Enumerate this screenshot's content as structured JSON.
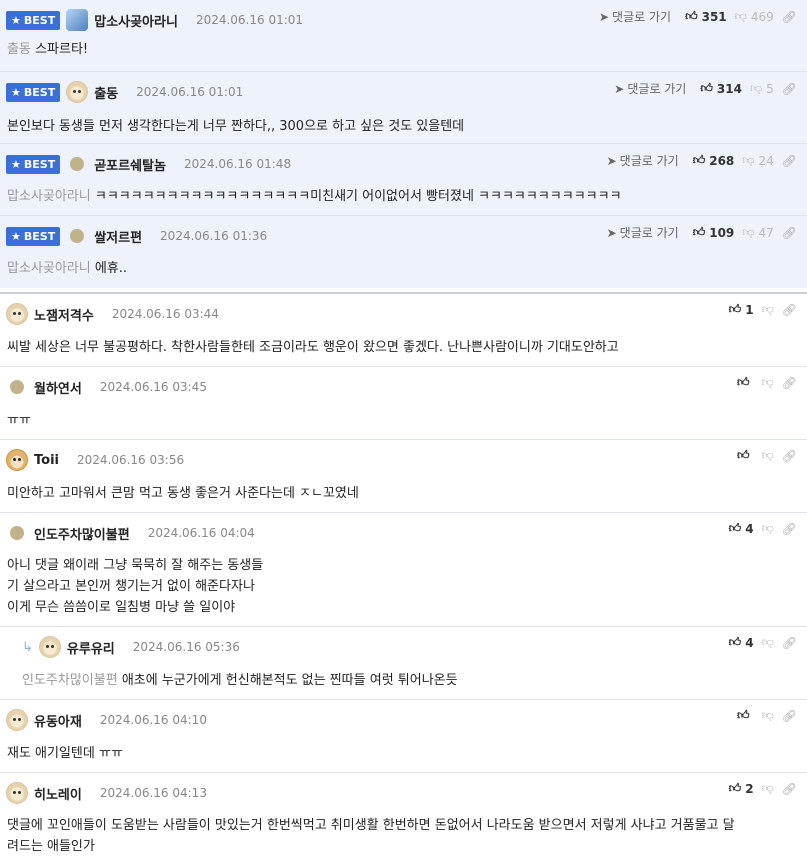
{
  "best_comments": [
    {
      "badge": "BEST",
      "avatar": "picture-avatar",
      "nick": "맙소사곶아라니",
      "date": "2024.06.16 01:01",
      "reply": "댓글로 가기",
      "up": "351",
      "down": "469",
      "mention": "",
      "text": "출동 스파르타!",
      "text_prefix": "출동"
    },
    {
      "badge": "BEST",
      "avatar": "dog-avatar",
      "nick": "출동",
      "date": "2024.06.16 01:01",
      "reply": "댓글로 가기",
      "up": "314",
      "down": "5",
      "mention": "",
      "text": "본인보다 동생들 먼저 생각한다는게 너무 짠하다,, 300으로 하고 싶은 것도 있을텐데"
    },
    {
      "badge": "BEST",
      "avatar": "dot-avatar",
      "nick": "곧포르쉐탈놈",
      "date": "2024.06.16 01:48",
      "reply": "댓글로 가기",
      "up": "268",
      "down": "24",
      "mention": "맙소사곶아라니",
      "text": "ㅋㅋㅋㅋㅋㅋㅋㅋㅋㅋㅋㅋㅋㅋㅋㅋㅋㅋ미친새기 어이없어서 빵터졌네 ㅋㅋㅋㅋㅋㅋㅋㅋㅋㅋㅋㅋ"
    },
    {
      "badge": "BEST",
      "avatar": "dot-avatar",
      "nick": "쌀저르편",
      "date": "2024.06.16 01:36",
      "reply": "댓글로 가기",
      "up": "109",
      "down": "47",
      "mention": "맙소사곶아라니",
      "text": "에휴.."
    }
  ],
  "comments": [
    {
      "avatar": "dog-avatar",
      "nick": "노잼저격수",
      "date": "2024.06.16 03:44",
      "up": "1",
      "lines": [
        "씨발 세상은 너무 불공평하다. 착한사람들한테 조금이라도 행운이 왔으면 좋겠다. 난나쁜사람이니까 기대도안하고"
      ]
    },
    {
      "avatar": "dot-avatar",
      "nick": "월하연서",
      "date": "2024.06.16 03:45",
      "up": "",
      "lines": [
        "ㅠㅠ"
      ]
    },
    {
      "avatar": "fox-avatar",
      "nick": "Toii",
      "date": "2024.06.16 03:56",
      "up": "",
      "lines": [
        "미안하고 고마워서 큰맘 먹고 동생 좋은거 사준다는데 ㅈㄴ꼬였네"
      ]
    },
    {
      "avatar": "dot-avatar",
      "nick": "인도주차많이불편",
      "date": "2024.06.16 04:04",
      "up": "4",
      "lines": [
        "아니 댓글 왜이래 그냥 묵묵히 잘 해주는 동생들",
        "기 살으라고 본인꺼 챙기는거 없이 해준다자나",
        "이게 무슨 씀씀이로 일침병 마냥 쓸 일이야"
      ]
    },
    {
      "avatar": "dog-avatar",
      "nick": "유루유리",
      "date": "2024.06.16 05:36",
      "up": "4",
      "mention": "인도주차많이불편",
      "lines": [
        "애초에 누군가에게 헌신해본적도 없는 찐따들 여럿 튀어나온듯"
      ]
    },
    {
      "avatar": "dog-avatar",
      "nick": "유동아재",
      "date": "2024.06.16 04:10",
      "up": "",
      "lines": [
        "재도 애기일텐데 ㅠㅠ"
      ]
    },
    {
      "avatar": "dog-avatar",
      "nick": "히노레이",
      "date": "2024.06.16 04:13",
      "up": "2",
      "lines": [
        "댓글에 꼬인애들이 도움받는 사람들이 맛있는거 한번씩먹고 취미생활 한번하면 돈없어서 나라도움 받으면서 저렇게 사냐고 거품물고 달",
        "려드는 애들인가"
      ]
    }
  ]
}
